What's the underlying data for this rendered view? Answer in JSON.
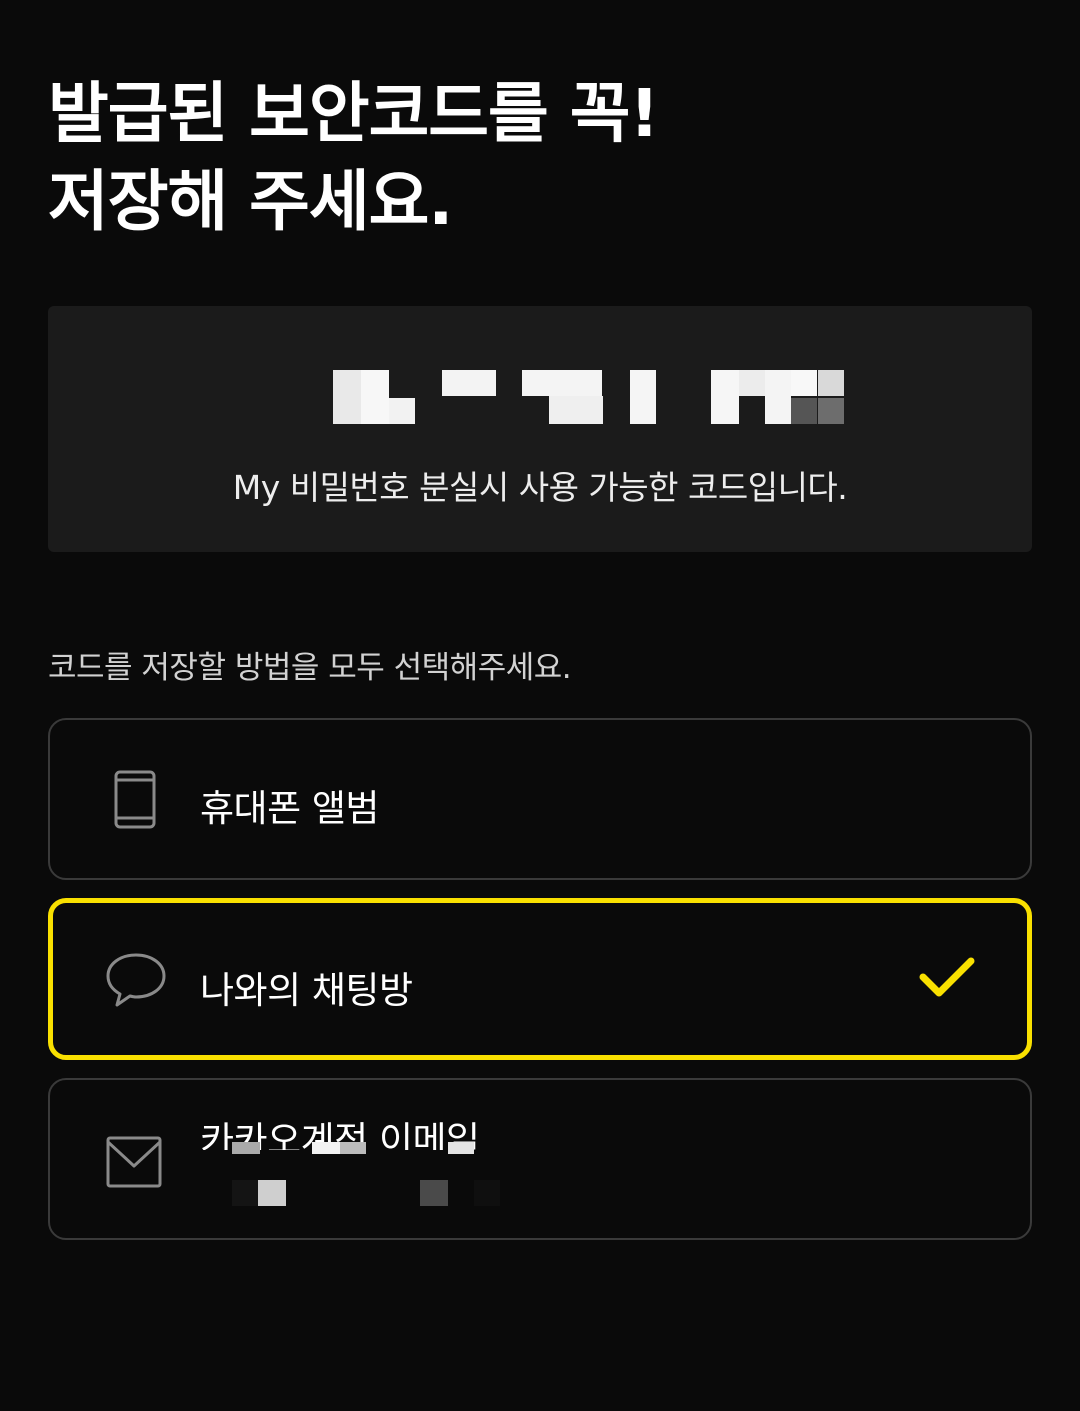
{
  "title": {
    "line1": "발급된 보안코드를 꼭!",
    "line2": "저장해 주세요."
  },
  "code_card": {
    "code_value": "",
    "caption": "My 비밀번호 분실시 사용 가능한 코드입니다."
  },
  "instruction": "코드를 저장할 방법을 모두 선택해주세요.",
  "options": [
    {
      "label": "휴대폰 앨범",
      "icon": "phone-icon",
      "selected": false
    },
    {
      "label": "나와의 채팅방",
      "icon": "chat-bubble-icon",
      "selected": true
    },
    {
      "label": "카카오계정 이메일",
      "icon": "mail-icon",
      "selected": false
    }
  ],
  "colors": {
    "background": "#0a0a0a",
    "card": "#1b1b1b",
    "accent": "#f9e000",
    "border": "#3a3a3a"
  }
}
